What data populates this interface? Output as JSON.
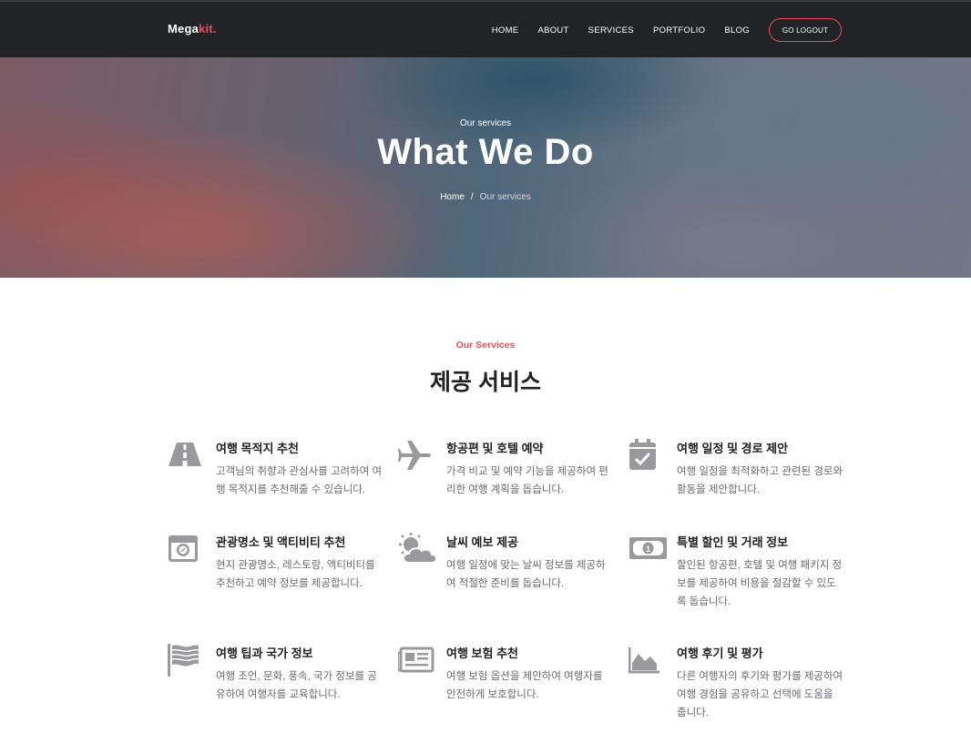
{
  "header": {
    "logo_main": "Mega",
    "logo_accent": "kit.",
    "nav": [
      "HOME",
      "ABOUT",
      "SERVICES",
      "PORTFOLIO",
      "BLOG"
    ],
    "logout_label": "GO LOGOUT"
  },
  "hero": {
    "subtitle": "Our services",
    "title": "What We Do",
    "breadcrumb_home": "Home",
    "breadcrumb_sep": "/",
    "breadcrumb_current": "Our services"
  },
  "section": {
    "label": "Our Services",
    "title": "제공 서비스"
  },
  "services": [
    {
      "icon": "road-icon",
      "title": "여행 목적지 추천",
      "desc": "고객님의 취향과 관심사를 고려하여 여행 목적지를 추천해줄 수 있습니다."
    },
    {
      "icon": "plane-icon",
      "title": "항공편 및 호텔 예약",
      "desc": "가격 비교 및 예약 기능을 제공하여 편리한 여행 계획을 돕습니다."
    },
    {
      "icon": "calendar-check-icon",
      "title": "여행 일정 및 경로 제안",
      "desc": "여행 일정을 최적화하고 관련된 경로와 활동을 제안합니다."
    },
    {
      "icon": "camera-icon",
      "title": "관광명소 및 액티비티 추천",
      "desc": "현지 관광명소, 레스토랑, 액티비티를 추천하고 예약 정보를 제공합니다."
    },
    {
      "icon": "weather-icon",
      "title": "날씨 예보 제공",
      "desc": "여행 일정에 맞는 날씨 정보를 제공하여 적절한 준비를 돕습니다."
    },
    {
      "icon": "money-icon",
      "title": "특별 할인 및 거래 정보",
      "desc": "할인된 항공편, 호텔 및 여행 패키지 정보를 제공하여 비용을 절감할 수 있도록 돕습니다."
    },
    {
      "icon": "flag-icon",
      "title": "여행 팁과 국가 정보",
      "desc": "여행 조언, 문화, 풍속, 국가 정보를 공유하여 여행자를 교육합니다."
    },
    {
      "icon": "newspaper-icon",
      "title": "여행 보험 추천",
      "desc": "여행 보험 옵션을 제안하여 여행자를 안전하게 보호합니다."
    },
    {
      "icon": "area-chart-icon",
      "title": "여행 후기 및 평가",
      "desc": "다른 여행자의 후기와 평가를 제공하여 여행 경험을 공유하고 선택에 도움을 줍니다."
    }
  ],
  "colors": {
    "accent": "#ef4c5a",
    "header_bg": "#222326",
    "icon_gray": "#9a9a9e"
  }
}
